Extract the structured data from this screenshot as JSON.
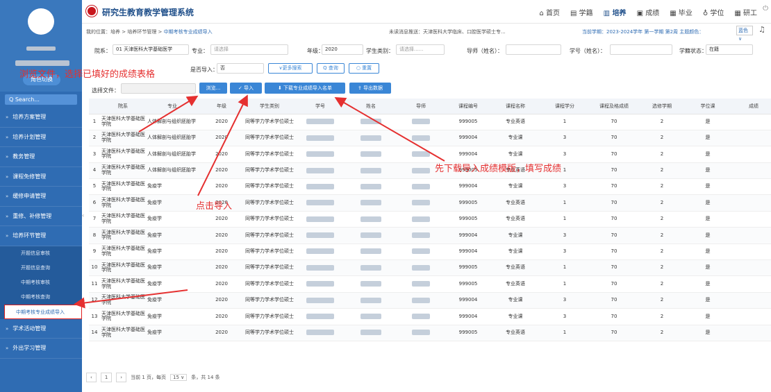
{
  "sidebar": {
    "role_button": "角色切换",
    "search_label": "Q  Search...",
    "items": [
      {
        "label": "培养方案管理"
      },
      {
        "label": "培养计划管理"
      },
      {
        "label": "教务管理"
      },
      {
        "label": "课程免修管理"
      },
      {
        "label": "缓修申请管理"
      },
      {
        "label": "重修、补修管理"
      },
      {
        "label": "培养环节管理"
      }
    ],
    "sub_items": [
      {
        "label": "开题信息审核"
      },
      {
        "label": "开题信息查询"
      },
      {
        "label": "中期考核审核"
      },
      {
        "label": "中期考核查询"
      },
      {
        "label": "中期考核专业成绩导入"
      }
    ],
    "items_after": [
      {
        "label": "学术活动管理"
      },
      {
        "label": "外出学习管理"
      }
    ]
  },
  "header": {
    "title": "研究生教育教学管理系统",
    "nav": [
      "首页",
      "学籍",
      "培养",
      "成绩",
      "毕业",
      "学位",
      "研工"
    ]
  },
  "breadcrumb": {
    "prefix": "我的位置：培养 > 培养环节管理 > ",
    "current": "中期考核专业成绩导入"
  },
  "notice": "未读消息推送：天津医科大学临床、口腔医学硕士专...",
  "term": "当前学期：2023-2024学年 第一学期 第2周  主题颜色：",
  "theme": "蓝色 ∨",
  "filters": {
    "department_label": "院系：",
    "department_value": "01 天津医科大学基础医学",
    "major_label": "专业：",
    "major_placeholder": "请选择",
    "grade_label": "年级：",
    "grade_value": "2020",
    "student_type_label": "学生类别：",
    "student_type_placeholder": "请选择......",
    "advisor_label": "导师（姓名）：",
    "student_id_label": "学号（姓名）：",
    "status_label": "学籍状态：",
    "status_value": "在籍",
    "imported_label": "是否导入：",
    "imported_value": "否",
    "more_search": "∨更多搜索",
    "query": "Q 查询",
    "reset": "○ 重置",
    "choose_file_label": "选择文件：",
    "browse": "浏览...",
    "import": "✓ 导入",
    "download_template": "⬇ 下载专业成绩导入名单",
    "export": "⇪ 导出数据"
  },
  "annotations": {
    "browse": "浏览文件，选择已填好的成绩表格",
    "click_import": "点击导入",
    "download_first": "先下载导入成绩模版，填写成绩"
  },
  "table": {
    "headers": [
      "",
      "院系",
      "专业",
      "年级",
      "学生类别",
      "学号",
      "姓名",
      "导师",
      "课程编号",
      "课程名称",
      "课程学分",
      "课程及格成绩",
      "选修学期",
      "学位课",
      "成绩"
    ],
    "rows": [
      {
        "no": "1",
        "dept": "天津医科大学基础医学院",
        "major": "人体解剖与组织胚胎学",
        "grade": "2020",
        "type": "同等学力学术学位硕士",
        "code": "999005",
        "course": "专业英语",
        "credit": "1",
        "pass": "70",
        "term": "2",
        "degree": "是"
      },
      {
        "no": "2",
        "dept": "天津医科大学基础医学院",
        "major": "人体解剖与组织胚胎学",
        "grade": "2020",
        "type": "同等学力学术学位硕士",
        "code": "999004",
        "course": "专业课",
        "credit": "3",
        "pass": "70",
        "term": "2",
        "degree": "是"
      },
      {
        "no": "3",
        "dept": "天津医科大学基础医学院",
        "major": "人体解剖与组织胚胎学",
        "grade": "2020",
        "type": "同等学力学术学位硕士",
        "code": "999004",
        "course": "专业课",
        "credit": "3",
        "pass": "70",
        "term": "2",
        "degree": "是"
      },
      {
        "no": "4",
        "dept": "天津医科大学基础医学院",
        "major": "人体解剖与组织胚胎学",
        "grade": "2020",
        "type": "同等学力学术学位硕士",
        "code": "999005",
        "course": "专业英语",
        "credit": "1",
        "pass": "70",
        "term": "2",
        "degree": "是"
      },
      {
        "no": "5",
        "dept": "天津医科大学基础医学院",
        "major": "免疫学",
        "grade": "2020",
        "type": "同等学力学术学位硕士",
        "code": "999004",
        "course": "专业课",
        "credit": "3",
        "pass": "70",
        "term": "2",
        "degree": "是"
      },
      {
        "no": "6",
        "dept": "天津医科大学基础医学院",
        "major": "免疫学",
        "grade": "2020",
        "type": "同等学力学术学位硕士",
        "code": "999005",
        "course": "专业英语",
        "credit": "1",
        "pass": "70",
        "term": "2",
        "degree": "是"
      },
      {
        "no": "7",
        "dept": "天津医科大学基础医学院",
        "major": "免疫学",
        "grade": "2020",
        "type": "同等学力学术学位硕士",
        "code": "999005",
        "course": "专业英语",
        "credit": "1",
        "pass": "70",
        "term": "2",
        "degree": "是"
      },
      {
        "no": "8",
        "dept": "天津医科大学基础医学院",
        "major": "免疫学",
        "grade": "2020",
        "type": "同等学力学术学位硕士",
        "code": "999004",
        "course": "专业课",
        "credit": "3",
        "pass": "70",
        "term": "2",
        "degree": "是"
      },
      {
        "no": "9",
        "dept": "天津医科大学基础医学院",
        "major": "免疫学",
        "grade": "2020",
        "type": "同等学力学术学位硕士",
        "code": "999004",
        "course": "专业课",
        "credit": "3",
        "pass": "70",
        "term": "2",
        "degree": "是"
      },
      {
        "no": "10",
        "dept": "天津医科大学基础医学院",
        "major": "免疫学",
        "grade": "2020",
        "type": "同等学力学术学位硕士",
        "code": "999005",
        "course": "专业英语",
        "credit": "1",
        "pass": "70",
        "term": "2",
        "degree": "是"
      },
      {
        "no": "11",
        "dept": "天津医科大学基础医学院",
        "major": "免疫学",
        "grade": "2020",
        "type": "同等学力学术学位硕士",
        "code": "999005",
        "course": "专业英语",
        "credit": "1",
        "pass": "70",
        "term": "2",
        "degree": "是"
      },
      {
        "no": "12",
        "dept": "天津医科大学基础医学院",
        "major": "免疫学",
        "grade": "2020",
        "type": "同等学力学术学位硕士",
        "code": "999004",
        "course": "专业课",
        "credit": "3",
        "pass": "70",
        "term": "2",
        "degree": "是"
      },
      {
        "no": "13",
        "dept": "天津医科大学基础医学院",
        "major": "免疫学",
        "grade": "2020",
        "type": "同等学力学术学位硕士",
        "code": "999004",
        "course": "专业课",
        "credit": "3",
        "pass": "70",
        "term": "2",
        "degree": "是"
      },
      {
        "no": "14",
        "dept": "天津医科大学基础医学院",
        "major": "免疫学",
        "grade": "2020",
        "type": "同等学力学术学位硕士",
        "code": "999005",
        "course": "专业英语",
        "credit": "1",
        "pass": "70",
        "term": "2",
        "degree": "是"
      }
    ]
  },
  "pager": {
    "current_page": "1",
    "text_prefix": "当前 1 页，每页",
    "page_size": "15 ∨",
    "text_suffix": "条，共 14 条"
  },
  "colors": {
    "sidebar": "#2f6cb3",
    "accent": "#3a86d6",
    "annotation": "#e53030"
  }
}
